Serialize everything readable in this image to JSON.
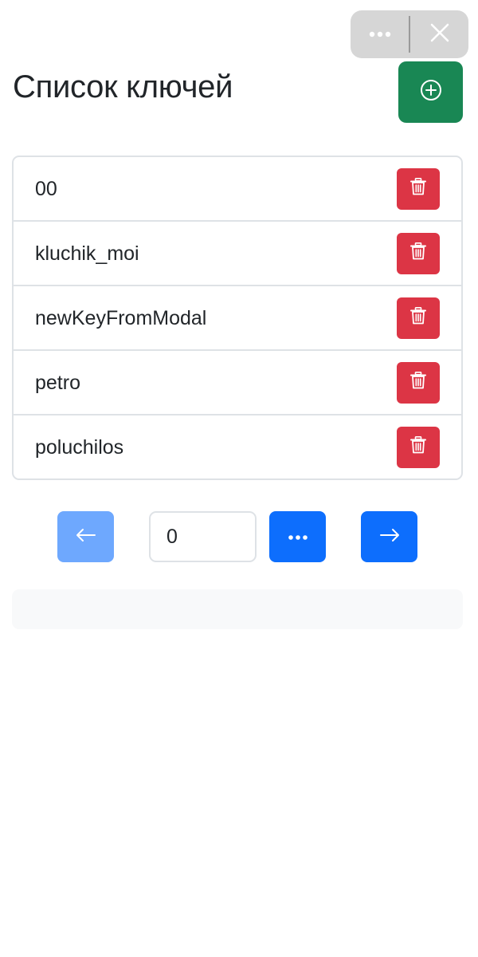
{
  "header": {
    "title": "Список ключей"
  },
  "capsule": {
    "menu_icon": "more-horizontal-icon",
    "close_icon": "close-icon"
  },
  "add_button": {
    "icon": "plus-circle-icon",
    "color": "#198754"
  },
  "keys": [
    {
      "name": "00"
    },
    {
      "name": "kluchik_moi"
    },
    {
      "name": "newKeyFromModal"
    },
    {
      "name": "petro"
    },
    {
      "name": "poluchilos"
    }
  ],
  "delete_button": {
    "icon": "trash-icon",
    "color": "#dc3545"
  },
  "pagination": {
    "prev_icon": "arrow-left-icon",
    "page_value": "0",
    "more_icon": "more-horizontal-icon",
    "next_icon": "arrow-right-icon",
    "prev_color": "#6ea8fe",
    "active_color": "#0d6efd"
  }
}
